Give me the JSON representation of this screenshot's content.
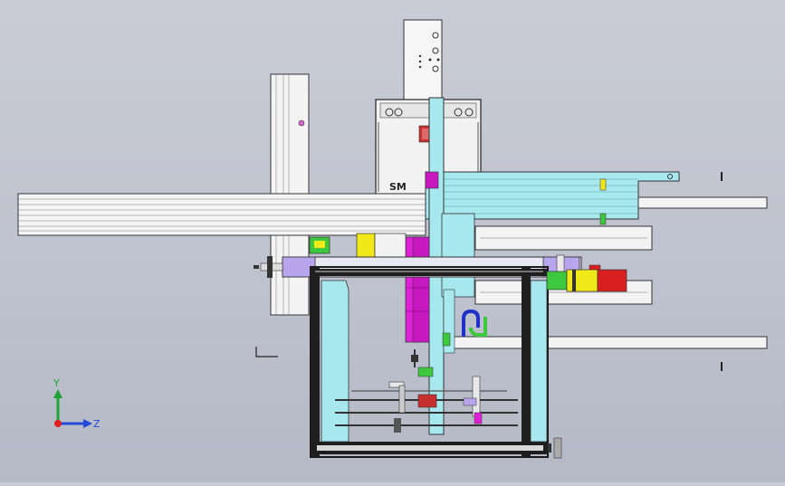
{
  "viewport": {
    "background": "#c4c7d1",
    "view": "front"
  },
  "triad": {
    "axis_y_label": "Y",
    "axis_z_label": "Z",
    "colors": {
      "y": "#1fa336",
      "z": "#2349d6",
      "x": "#e02020"
    }
  },
  "model": {
    "nameplate_text": "SM",
    "colors": {
      "frame": "#1a1a1a",
      "plate": "#f4f4f4",
      "cyan": "#a6e8ee",
      "magenta": "#e020d8",
      "yellow": "#f0e818",
      "green": "#3ec83e",
      "red": "#d82020",
      "purple": "#9a78e0",
      "blue": "#2030c8"
    }
  }
}
